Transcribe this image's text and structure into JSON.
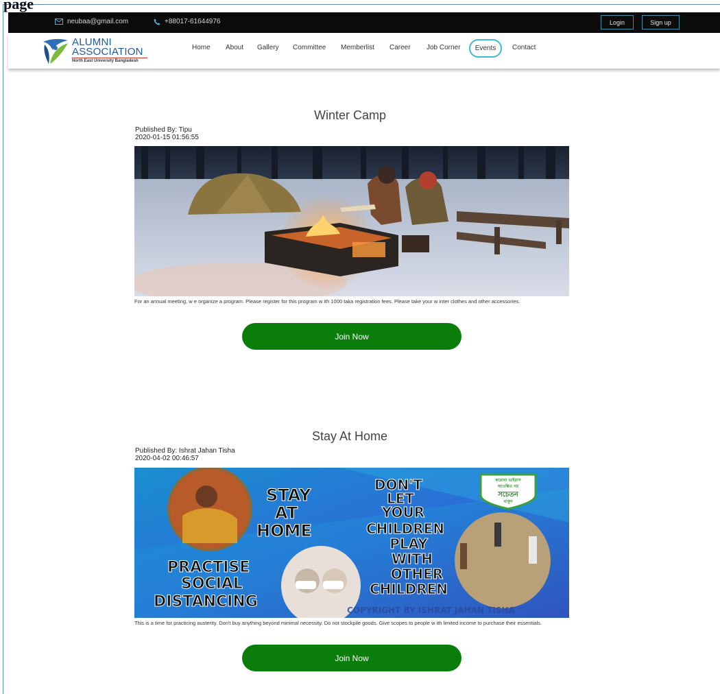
{
  "corner_text": "page",
  "topbar": {
    "email": "neubaa@gmail.com",
    "phone": "+88017-61644976",
    "login_label": "Login",
    "signup_label": "Sign up"
  },
  "logo": {
    "line1": "ALUMNI",
    "line2": "ASSOCIATION",
    "subtitle": "North East University Bangladesh"
  },
  "nav": {
    "items": [
      "Home",
      "About",
      "Gallery",
      "Committee",
      "Memberlist",
      "Career",
      "Job Corner",
      "Events",
      "Contact"
    ],
    "active": "Events"
  },
  "events": [
    {
      "title": "Winter Camp",
      "published_by": "Published By: Tipu",
      "datetime": "2020-01-15 01:56:55",
      "description": "For an annual meeting, w e organize a program. Please register for this program w ith 1000 taka registration fees. Please take your w inter clothes and other accessories.",
      "button": "Join Now"
    },
    {
      "title": "Stay At Home",
      "published_by": "Published By: Ishrat Jahan Tisha",
      "datetime": "2020-04-02 00:46:57",
      "description": "This is a time for practicing austerity. Don't buy anything beyond minimal necessity. Do not stockpile goods. Give scopes to people w ith limited income to purchase their essentials.",
      "button": "Join Now",
      "poster": {
        "left_text": [
          "STAY",
          "AT",
          "HOME"
        ],
        "bottom_text": [
          "PRACTISE",
          "SOCIAL",
          "DISTANCING"
        ],
        "right_text": [
          "DON'T",
          "LET",
          "YOUR",
          "CHILDREN",
          "PLAY",
          "WITH",
          "OTHER",
          "CHILDREN"
        ],
        "badge": [
          "করোনা ভাইরাস",
          "আতঙ্কিত নয়",
          "সচেতন",
          "থাকুন"
        ],
        "copyright": "COPYRIGHT BY ISHRAT JAHAN TISHA"
      }
    }
  ]
}
